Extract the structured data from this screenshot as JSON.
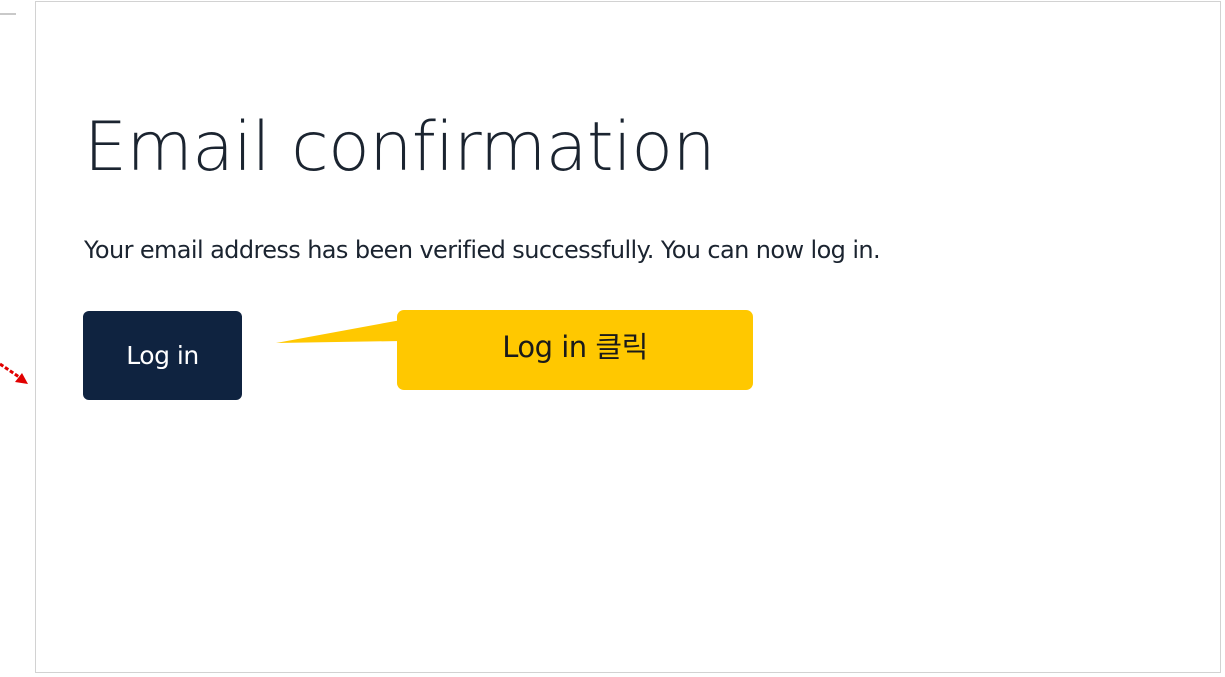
{
  "page": {
    "title": "Email confirmation",
    "message": "Your email address has been verified successfully. You can now log in."
  },
  "actions": {
    "login_label": "Log in"
  },
  "annotation": {
    "callout_text": "Log in 클릭",
    "callout_color": "#ffc800",
    "arrow_color": "#e10000"
  },
  "colors": {
    "button_bg": "#0f2340",
    "text": "#1b2430",
    "card_border": "#d2d2d2"
  }
}
